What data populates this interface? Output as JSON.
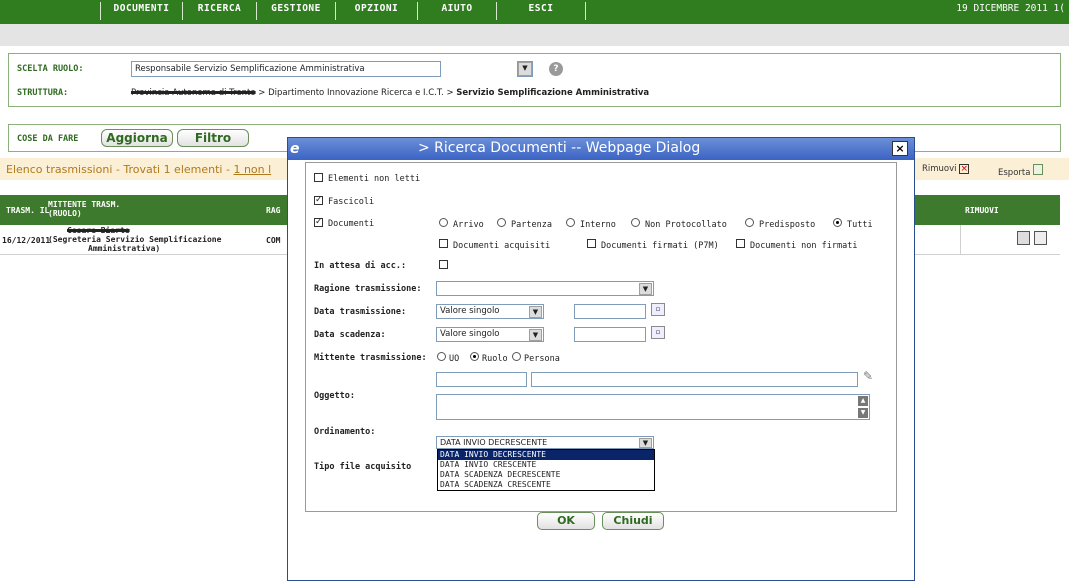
{
  "menu": {
    "items": [
      "DOCUMENTI",
      "RICERCA",
      "GESTIONE",
      "OPZIONI",
      "AIUTO",
      "ESCI"
    ],
    "date": "19 DICEMBRE 2011 1("
  },
  "ruolo": {
    "label": "SCELTA RUOLO:",
    "value": "Responsabile Servizio Semplificazione Amministrativa",
    "struttura_label": "STRUTTURA:",
    "struttura_redacted": "Provincia Autonoma di Trento",
    "struttura_path": " > Dipartimento Innovazione Ricerca e I.C.T. > ",
    "struttura_last": "Servizio Semplificazione Amministrativa"
  },
  "cose": {
    "label": "COSE DA FARE",
    "aggiorna": "Aggiorna",
    "filtro": "Filtro"
  },
  "elenco": {
    "text": "Elenco trasmissioni - Trovati 1 elementi - ",
    "link": "1 non l",
    "rimuovi": "Rimuovi",
    "esporta": "Esporta"
  },
  "table": {
    "headers": {
      "trasm": "TRASM. IL",
      "mittente": "MITTENTE TRASM.",
      "mittente2": "(RUOLO)",
      "rag": "RAG",
      "rimuovi": "RIMUOVI"
    },
    "row": {
      "date": "16/12/2011",
      "redacted": "Cesare Biarte",
      "mittente": "(Segreteria Servizio Semplificazione",
      "mittente2": "Amministrativa)",
      "rag": "COM"
    }
  },
  "dialog": {
    "title": "> Ricerca Documenti -- Webpage Dialog",
    "close": "×",
    "elementi_non_letti": "Elementi non letti",
    "fascicoli": "Fascicoli",
    "documenti": "Documenti",
    "tipi": [
      "Arrivo",
      "Partenza",
      "Interno",
      "Non Protocollato",
      "Predisposto",
      "Tutti"
    ],
    "doc_acquisiti": "Documenti acquisiti",
    "doc_firmati": "Documenti firmati (P7M)",
    "doc_non_firmati": "Documenti non firmati",
    "in_attesa": "In attesa di acc.:",
    "ragione": "Ragione trasmissione:",
    "data_trasmissione": "Data trasmissione:",
    "data_scadenza": "Data scadenza:",
    "valore_singolo": "Valore singolo",
    "mittente": "Mittente trasmissione:",
    "mitt_opts": [
      "UO",
      "Ruolo",
      "Persona"
    ],
    "oggetto": "Oggetto:",
    "ordinamento": "Ordinamento:",
    "ord_selected": "DATA INVIO DECRESCENTE",
    "ord_options": [
      "DATA INVIO DECRESCENTE",
      "DATA INVIO CRESCENTE",
      "DATA SCADENZA DECRESCENTE",
      "DATA SCADENZA CRESCENTE"
    ],
    "tipo_file": "Tipo file acquisito",
    "ok": "OK",
    "chiudi": "Chiudi"
  },
  "colors": {
    "green": "#2f7d1f",
    "title_blue": "#3b63c4"
  }
}
